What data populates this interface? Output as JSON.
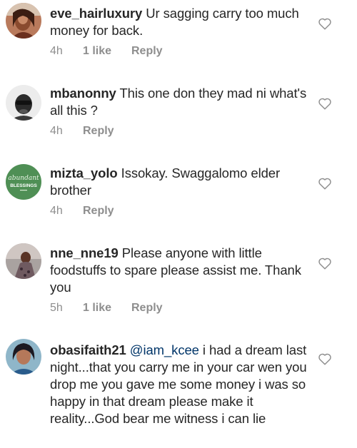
{
  "comments": [
    {
      "username": "eve_hairluxury",
      "text": "Ur sagging carry too much money for back.",
      "time": "4h",
      "likes": "1 like",
      "reply": "Reply"
    },
    {
      "username": "mbanonny",
      "text": "This one don they mad ni what's all this ?",
      "time": "4h",
      "likes": "",
      "reply": "Reply"
    },
    {
      "username": "mizta_yolo",
      "text": "Issokay. Swaggalomo elder brother",
      "time": "4h",
      "likes": "",
      "reply": "Reply",
      "avatar_text": [
        "abundant",
        "BLESSINGS"
      ]
    },
    {
      "username": "nne_nne19",
      "text": "Please anyone with little foodstuffs to spare please assist me. Thank you",
      "time": "5h",
      "likes": "1 like",
      "reply": "Reply"
    },
    {
      "username": "obasifaith21",
      "mention": "@iam_kcee",
      "text": "i had a dream last night...that you carry me in your car wen you drop me you gave me some money i was so happy in that dream please make it reality...God bear me witness i can lie"
    }
  ],
  "icons": {
    "like": "heart-outline-icon"
  },
  "colors": {
    "text": "#262626",
    "meta": "#8e8e8e",
    "mention": "#003569",
    "avatar3_bg": "#4f8f55"
  }
}
